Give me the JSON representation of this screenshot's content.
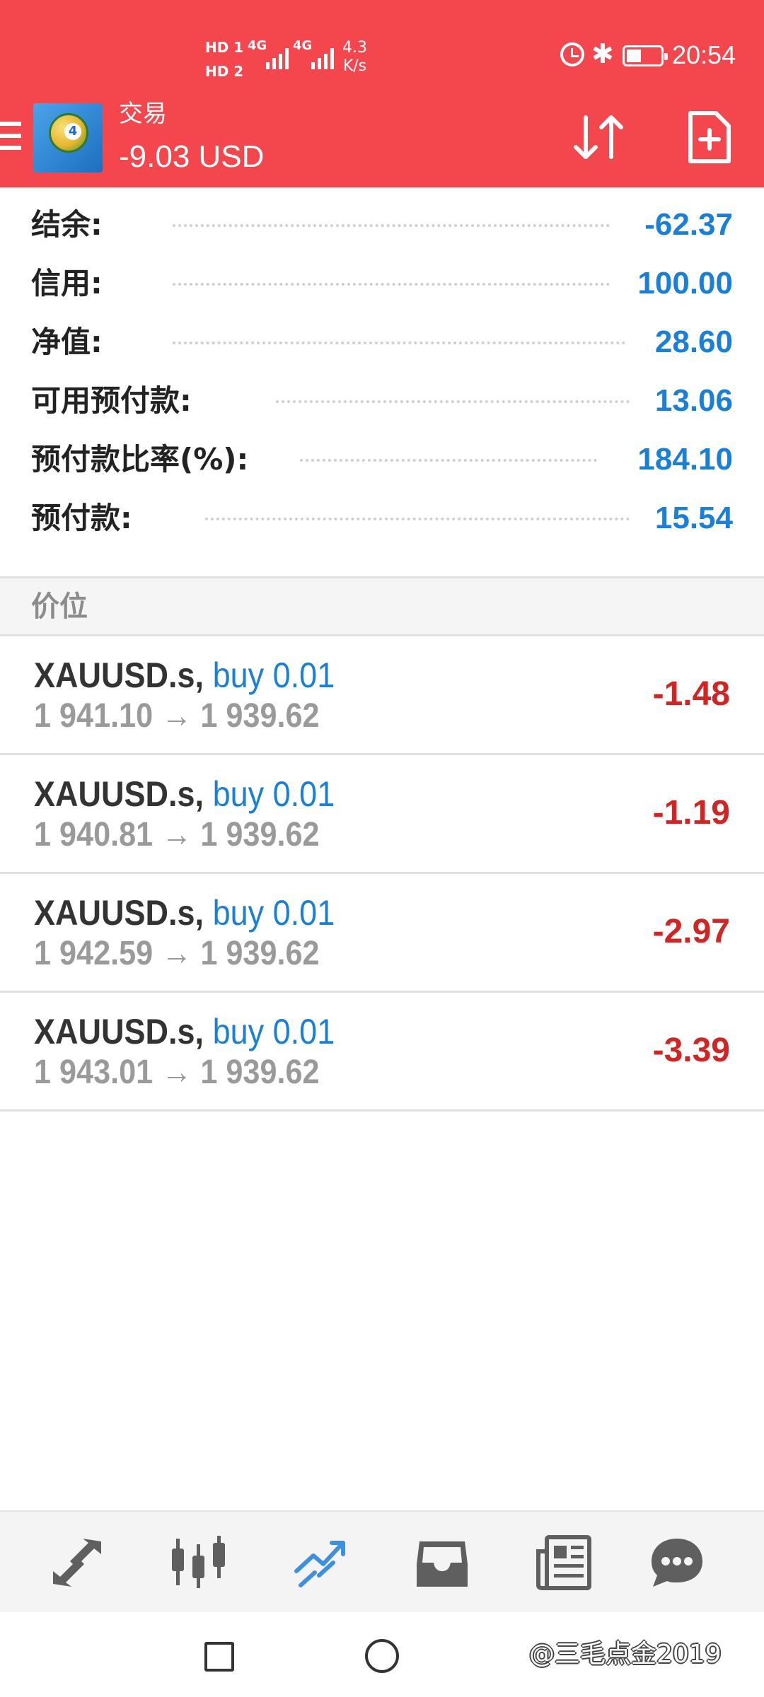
{
  "status_bar": {
    "hd_sim1": "HD 1",
    "hd_sim2": "HD 2",
    "network_1": "4G",
    "network_2": "4G",
    "speed_value": "4.3",
    "speed_unit": "K/s",
    "time": "20:54",
    "icons": [
      "alarm-icon",
      "bluetooth-icon",
      "battery-icon"
    ]
  },
  "toolbar": {
    "title": "交易",
    "balance_display": "-9.03 USD",
    "icons": [
      "menu-icon",
      "app-logo-icon",
      "sort-icon",
      "new-order-icon"
    ]
  },
  "summary": [
    {
      "label": "结余:",
      "value": "-62.37"
    },
    {
      "label": "信用:",
      "value": "100.00"
    },
    {
      "label": "净值:",
      "value": "28.60"
    },
    {
      "label": "可用预付款:",
      "value": "13.06"
    },
    {
      "label": "预付款比率(%):",
      "value": "184.10"
    },
    {
      "label": "预付款:",
      "value": "15.54"
    }
  ],
  "section": {
    "title": "价位"
  },
  "positions": [
    {
      "symbol": "XAUUSD.s,",
      "side": "buy 0.01",
      "prices": "1 941.10 → 1 939.62",
      "profit": "-1.48"
    },
    {
      "symbol": "XAUUSD.s,",
      "side": "buy 0.01",
      "prices": "1 940.81 → 1 939.62",
      "profit": "-1.19"
    },
    {
      "symbol": "XAUUSD.s,",
      "side": "buy 0.01",
      "prices": "1 942.59 → 1 939.62",
      "profit": "-2.97"
    },
    {
      "symbol": "XAUUSD.s,",
      "side": "buy 0.01",
      "prices": "1 943.01 → 1 939.62",
      "profit": "-3.39"
    }
  ],
  "bottom_nav": {
    "items": [
      "quotes-icon",
      "chart-icon",
      "trade-icon",
      "history-icon",
      "news-icon",
      "chat-icon"
    ],
    "active": "trade-icon",
    "active_color": "#3d8fe0",
    "inactive_color": "#5f5f5f"
  },
  "system_nav": {
    "items": [
      "recents-icon",
      "home-icon"
    ]
  },
  "watermark": "@三毛点金2019",
  "colors": {
    "header_bg": "#f4464d",
    "value_blue": "#1a7fd9",
    "loss_red": "#d32424",
    "price_gray": "#9a9a9a"
  }
}
